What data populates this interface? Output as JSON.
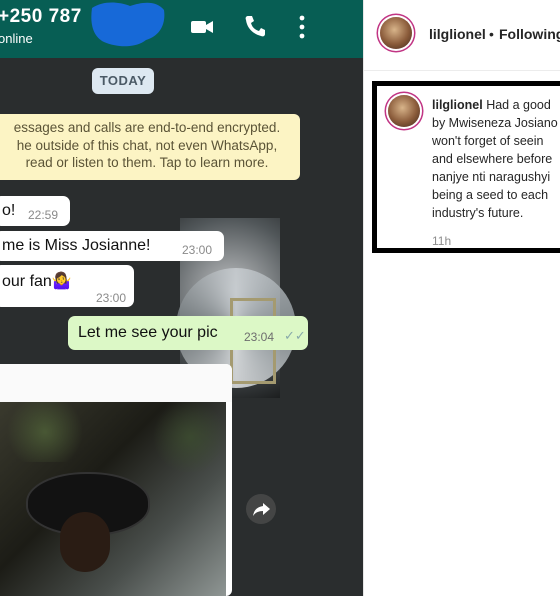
{
  "whatsapp": {
    "contact_number": "+250 787",
    "status": "online",
    "date_chip": "TODAY",
    "encryption_notice": [
      "essages and calls are end-to-end encrypted.",
      "he outside of this chat, not even WhatsApp,",
      "read or listen to them. Tap to learn more."
    ],
    "messages": [
      {
        "text": "o!",
        "time": "22:59"
      },
      {
        "text": "me is Miss Josianne!",
        "time": "23:00"
      },
      {
        "text": "our fan🤷‍♀️",
        "time": "23:00"
      }
    ],
    "outgoing": {
      "text": "Let me see your pic",
      "time": "23:04",
      "ticks": "✓✓"
    }
  },
  "instagram": {
    "header_username": "lilglionel",
    "separator": "•",
    "follow_status": "Following",
    "caption": {
      "username": "lilglionel",
      "lines": [
        "Had a good",
        "by Mwiseneza Josiano",
        "won't forget of seein",
        "and elsewhere before",
        "nanjye nti naragushyi",
        "being a seed to each",
        "industry's future."
      ],
      "time": "11h"
    }
  },
  "colors": {
    "wa_header": "#075e54",
    "wa_outgoing": "#dcf8c6",
    "wa_notice": "#fcf4c4",
    "redaction": "#1769d8",
    "ig_ring": "#c13584"
  }
}
